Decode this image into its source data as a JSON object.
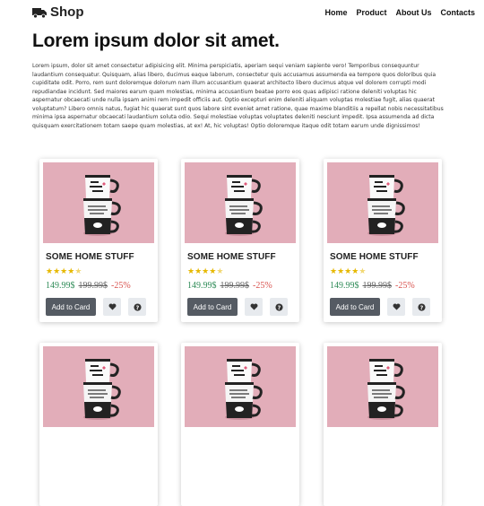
{
  "header": {
    "brand": "Shop",
    "nav": [
      {
        "label": "Home"
      },
      {
        "label": "Product"
      },
      {
        "label": "About Us"
      },
      {
        "label": "Contacts"
      }
    ]
  },
  "hero": {
    "title": "Lorem ipsum dolor sit amet.",
    "text": "Lorem ipsum, dolor sit amet consectetur adipisicing elit. Minima perspiciatis, aperiam sequi veniam sapiente vero! Temporibus consequuntur laudantium consequatur. Quisquam, alias libero, ducimus eaque laborum, consectetur quis accusamus assumenda ea tempore quos doloribus quia cupiditate odit. Porro, rem sunt doloremque dolorum nam illum accusantium quaerat architecto libero ducimus atque vel dolorem corrupti modi repudiandae incidunt. Sed maiores earum quam molestias, minima accusantium beatae porro eos quas adipisci ratione deleniti voluptas hic aspernatur obcaecati unde nulla ipsam animi rem impedit officiis aut. Optio excepturi enim deleniti aliquam voluptas molestiae fugit, alias quaerat voluptatum? Libero omnis natus, fugiat hic quaerat sunt quos labore sint eveniet amet ratione, quae maxime blanditiis a repellat nobis necessitatibus minima ipsa aspernatur obcaecati laudantium soluta odio. Sequi molestiae voluptas voluptates deleniti nesciunt impedit. Ipsa assumenda ad dicta quisquam exercitationem totam saepe quam molestias, at ex! At, hic voluptas! Optio doloremque itaque odit totam earum unde dignissimos!"
  },
  "products": [
    {
      "name": "SOME HOME STUFF",
      "rating": 4.5,
      "price": "149.99$",
      "old_price": "199.99$",
      "discount": "-25%",
      "cart_label": "Add to Card",
      "image": "mug-stack-best-mom"
    },
    {
      "name": "SOME HOME STUFF",
      "rating": 4.5,
      "price": "149.99$",
      "old_price": "199.99$",
      "discount": "-25%",
      "cart_label": "Add to Card",
      "image": "mug-stack-best-mom"
    },
    {
      "name": "SOME HOME STUFF",
      "rating": 4.5,
      "price": "149.99$",
      "old_price": "199.99$",
      "discount": "-25%",
      "cart_label": "Add to Card",
      "image": "mug-stack-best-mom"
    },
    {
      "name": "",
      "image": "mug-stack-best-mom"
    },
    {
      "name": "",
      "image": "mug-stack-best-mom"
    },
    {
      "name": "",
      "image": "mug-stack-best-mom"
    }
  ],
  "icons": {
    "logo": "truck-icon",
    "favorite": "heart-icon",
    "info": "question-icon"
  },
  "colors": {
    "price": "#2e8b57",
    "discount": "#d9534f",
    "star": "#e6b800",
    "button": "#555b63",
    "photo_bg": "#e2adb9"
  }
}
